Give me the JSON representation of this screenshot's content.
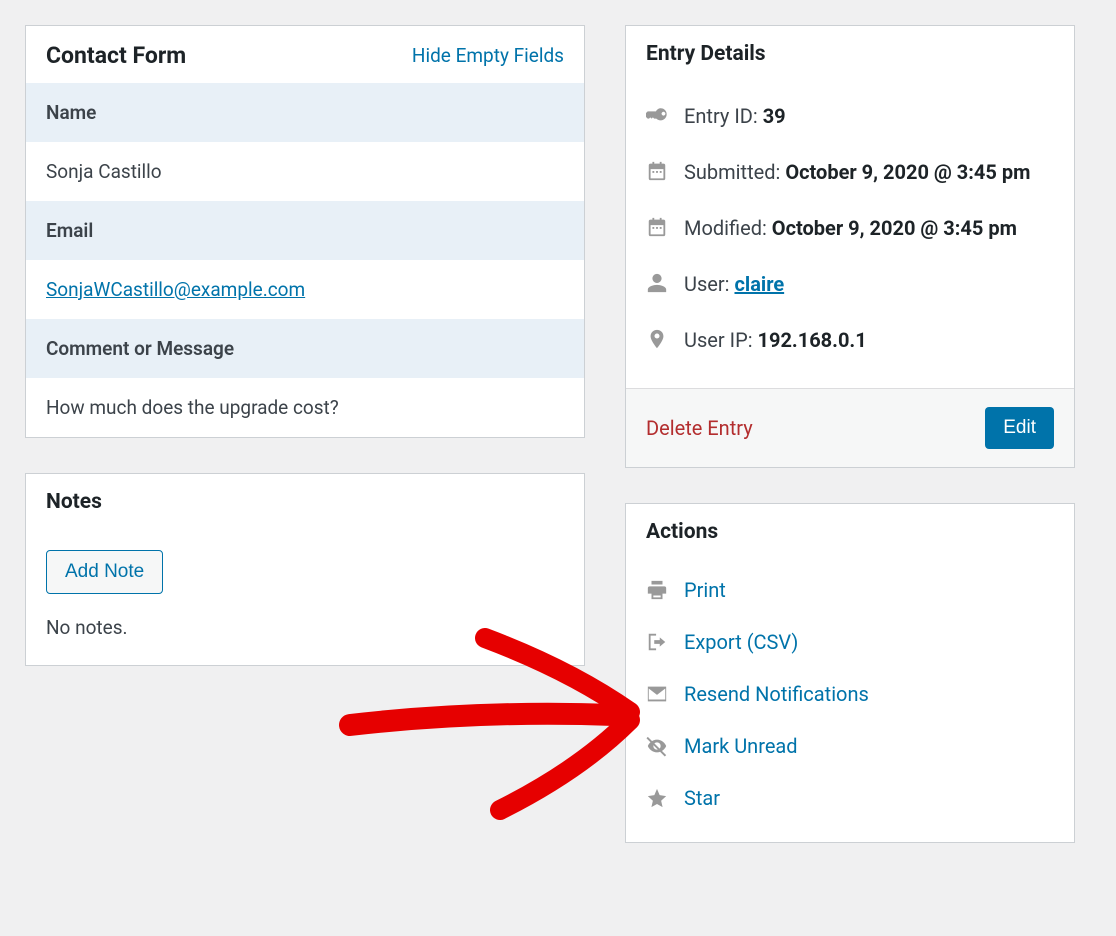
{
  "contactForm": {
    "title": "Contact Form",
    "hideLink": "Hide Empty Fields",
    "fields": {
      "name_label": "Name",
      "name_value": "Sonja Castillo",
      "email_label": "Email",
      "email_value": "SonjaWCastillo@example.com",
      "comment_label": "Comment or Message",
      "comment_value": "How much does the upgrade cost?"
    }
  },
  "notes": {
    "title": "Notes",
    "addNote": "Add Note",
    "empty": "No notes."
  },
  "entryDetails": {
    "title": "Entry Details",
    "entryIdLabel": "Entry ID: ",
    "entryId": "39",
    "submittedLabel": "Submitted: ",
    "submitted": "October 9, 2020 @ 3:45 pm",
    "modifiedLabel": "Modified: ",
    "modified": "October 9, 2020 @ 3:45 pm",
    "userLabel": "User: ",
    "user": "claire",
    "userIpLabel": "User IP: ",
    "userIp": "192.168.0.1",
    "deleteEntry": "Delete Entry",
    "edit": "Edit"
  },
  "actions": {
    "title": "Actions",
    "print": "Print",
    "export": "Export (CSV)",
    "resend": "Resend Notifications",
    "markUnread": "Mark Unread",
    "star": "Star"
  }
}
